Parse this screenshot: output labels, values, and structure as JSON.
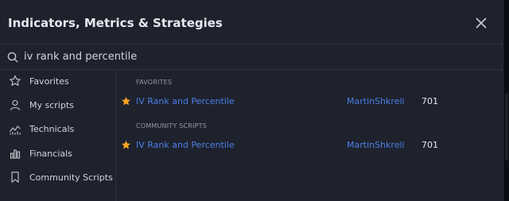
{
  "dialog": {
    "title": "Indicators, Metrics & Strategies"
  },
  "search": {
    "value": "iv rank and percentile"
  },
  "sidebar": {
    "items": [
      {
        "label": "Favorites",
        "icon": "star-outline-icon"
      },
      {
        "label": "My scripts",
        "icon": "user-icon"
      },
      {
        "label": "Technicals",
        "icon": "technicals-chart-icon"
      },
      {
        "label": "Financials",
        "icon": "bar-chart-icon"
      },
      {
        "label": "Community Scripts",
        "icon": "bookmark-icon"
      }
    ]
  },
  "results": {
    "favorites_title": "FAVORITES",
    "favorites": [
      {
        "name": "IV Rank and Percentile",
        "author": "MartinShkreli",
        "likes": "701"
      }
    ],
    "community_title": "COMMUNITY SCRIPTS",
    "community": [
      {
        "name": "IV Rank and Percentile",
        "author": "MartinShkreli",
        "likes": "701"
      }
    ]
  },
  "colors": {
    "background": "#1e222d",
    "link": "#4c7fe6",
    "star": "#f5a623"
  }
}
